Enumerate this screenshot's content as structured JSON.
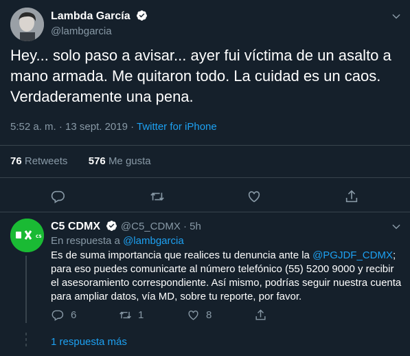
{
  "tweet": {
    "author_name": "Lambda García",
    "author_handle": "@lambgarcia",
    "text": "Hey... solo paso a avisar... ayer fui víctima de un asalto a mano armada. Me quitaron todo. La cuidad es un caos. Verdaderamente una pena.",
    "time": "5:52 a. m. · 13 sept. 2019 · ",
    "source": "Twitter for iPhone",
    "retweets_count": "76",
    "retweets_label": "Retweets",
    "likes_count": "576",
    "likes_label": "Me gusta"
  },
  "reply": {
    "author_name": "C5 CDMX",
    "author_handle": "@C5_CDMX · 5h",
    "in_reply_prefix": "En respuesta a ",
    "in_reply_handle": "@lambgarcia",
    "text_before": "Es de suma importancia que realices tu denuncia ante la ",
    "mention": "@PGJDF_CDMX",
    "text_after": "; para eso puedes comunicarte al número telefónico (55) 5200 9000 y recibir el asesoramiento correspondiente. Así mismo, podrías seguir nuestra cuenta para ampliar datos, vía MD, sobre tu reporte, por favor.",
    "reply_count": "6",
    "retweet_count": "1",
    "like_count": "8",
    "avatar_text": "C5"
  },
  "more_replies": "1 respuesta más",
  "colors": {
    "background": "#15202b",
    "accent": "#1da1f2",
    "muted": "#8899a6",
    "divider": "#38444d",
    "c5_green": "#1aba34"
  }
}
